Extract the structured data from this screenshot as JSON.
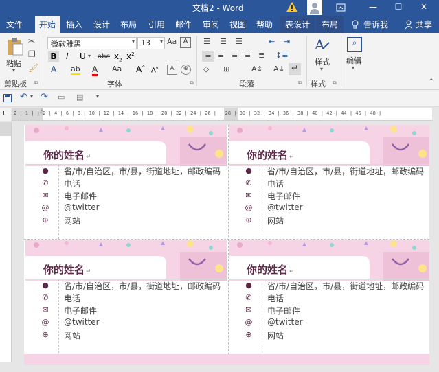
{
  "titlebar": {
    "title": "文档2 - Word",
    "minimize": "—",
    "restore": "☐",
    "close": "✕"
  },
  "menu": {
    "file": "文件",
    "home": "开始",
    "insert": "插入",
    "design": "设计",
    "layout": "布局",
    "references": "引用",
    "mailings": "邮件",
    "review": "审阅",
    "view": "视图",
    "help": "帮助",
    "table_design": "表设计",
    "table_layout": "布局",
    "tell_me": "告诉我",
    "share": "共享"
  },
  "ribbon": {
    "paste": "粘贴",
    "font_name": "微软雅黑",
    "font_size": "13",
    "styles": "样式",
    "editing": "编辑",
    "groups": {
      "clipboard": "剪贴板",
      "font": "字体",
      "paragraph": "段落",
      "styles": "样式"
    }
  },
  "ruler": {
    "h_marks": "2 | 1 |    | 2 | 4 | 6 | 8 | 10 | 12 | 14 | 16 | 18 | 20 | 22 | 24 | 26 |    | 28 | 30 | 32 | 34 | 36 | 38 | 40 | 42 | 44 | 46 | 48 |"
  },
  "cards": [
    {
      "name": "你的姓名",
      "address": "省/市/自治区，市/县，街道地址，邮政编码",
      "phone": "电话",
      "email": "电子邮件",
      "twitter": "@twitter",
      "website": "网站"
    },
    {
      "name": "你的姓名",
      "address": "省/市/自治区，市/县，街道地址，邮政编码",
      "phone": "电话",
      "email": "电子邮件",
      "twitter": "@twitter",
      "website": "网站"
    },
    {
      "name": "你的姓名",
      "address": "省/市/自治区，市/县，街道地址，邮政编码",
      "phone": "电话",
      "email": "电子邮件",
      "twitter": "@twitter",
      "website": "网站"
    },
    {
      "name": "你的姓名",
      "address": "省/市/自治区，市/县，街道地址，邮政编码",
      "phone": "电话",
      "email": "电子邮件",
      "twitter": "@twitter",
      "website": "网站"
    }
  ],
  "colors": {
    "word_blue": "#2b579a",
    "name_color": "#5a2a48",
    "banner_pink": "#f7d3e6"
  }
}
